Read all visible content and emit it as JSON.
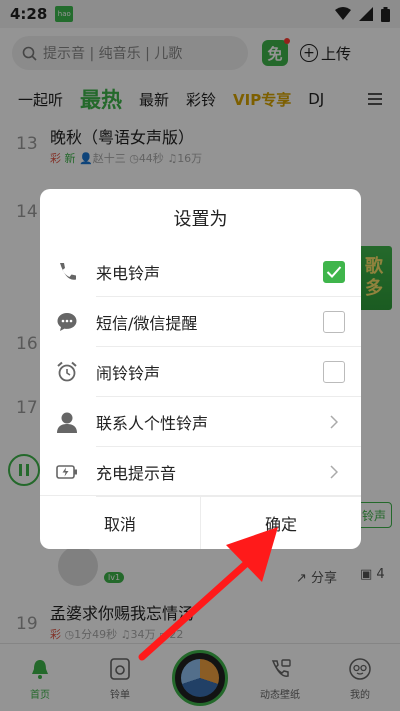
{
  "status_bar": {
    "time": "4:28",
    "badge": "hao"
  },
  "search": {
    "placeholder": "提示音 | 纯音乐 | 儿歌"
  },
  "header": {
    "free_label": "免",
    "upload_label": "上传"
  },
  "tabs": [
    {
      "label": "一起听"
    },
    {
      "label": "最热"
    },
    {
      "label": "最新"
    },
    {
      "label": "彩铃"
    },
    {
      "label": "VIP专享"
    },
    {
      "label": "DJ"
    }
  ],
  "songs": [
    {
      "rank": "13",
      "title": "晚秋（粤语女声版）",
      "tag": "彩",
      "badge": "新",
      "artist": "赵十三",
      "duration": "44秒",
      "plays": "16万"
    },
    {
      "rank": "14"
    },
    {
      "rank": "16"
    },
    {
      "rank": "17"
    },
    {
      "rank": "19",
      "title": "孟婆求你赐我忘情汤",
      "tag": "彩",
      "duration": "1分49秒",
      "plays": "34万",
      "comments": "22"
    }
  ],
  "ad": {
    "text_1": "歌",
    "text_2": "多"
  },
  "actions": {
    "ringtone_label": "铃声",
    "share_label": "分享",
    "comment_count": "4",
    "level_badge": "lv1"
  },
  "dialog": {
    "title": "设置为",
    "options": [
      {
        "label": "来电铃声",
        "checked": true
      },
      {
        "label": "短信/微信提醒",
        "checked": false
      },
      {
        "label": "闹铃铃声",
        "checked": false
      },
      {
        "label": "联系人个性铃声"
      },
      {
        "label": "充电提示音"
      }
    ],
    "cancel_label": "取消",
    "confirm_label": "确定"
  },
  "bottom_nav": [
    {
      "label": "首页"
    },
    {
      "label": "铃单"
    },
    {
      "label": "动态壁纸"
    },
    {
      "label": "我的"
    }
  ],
  "colors": {
    "accent": "#3fb54b",
    "annotation_arrow": "#ff1a1a",
    "vip": "#d8a400"
  }
}
